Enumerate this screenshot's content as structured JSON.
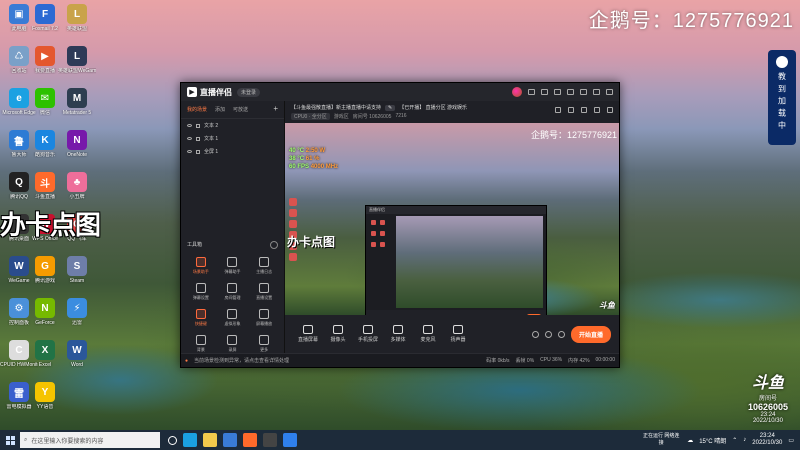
{
  "watermark": {
    "top_text": "企鹅号：1275776921",
    "big_text": "办卡点图"
  },
  "side_badge": {
    "label": "教 到 加 载 中"
  },
  "bottom_logo": {
    "brand": "斗鱼",
    "room_label": "房间号",
    "room_id": "10626005",
    "time": "23:24",
    "date": "2022/10/30"
  },
  "desktop_icons": [
    {
      "label": "此电脑",
      "color": "#3a7bd5",
      "glyph": "▣"
    },
    {
      "label": "Foxmail 7.2",
      "color": "#2c6ad3",
      "glyph": "F"
    },
    {
      "label": "英雄联盟",
      "color": "#c9a34a",
      "glyph": "L"
    },
    {
      "label": "回收站",
      "color": "#7aa0c8",
      "glyph": "♺"
    },
    {
      "label": "我要直播",
      "color": "#e4572e",
      "glyph": "▶"
    },
    {
      "label": "英雄联盟WeGame",
      "color": "#2e3a57",
      "glyph": "L"
    },
    {
      "label": "Microsoft Edge",
      "color": "#1ba1e2",
      "glyph": "e"
    },
    {
      "label": "微信",
      "color": "#2dc100",
      "glyph": "✉"
    },
    {
      "label": "Metatrader 5",
      "color": "#2d3e50",
      "glyph": "M"
    },
    {
      "label": "鲁大师",
      "color": "#2d7bd4",
      "glyph": "鲁"
    },
    {
      "label": "酷狗音乐",
      "color": "#1b86e0",
      "glyph": "K"
    },
    {
      "label": "OneNote",
      "color": "#7719aa",
      "glyph": "N"
    },
    {
      "label": "腾讯QQ",
      "color": "#222",
      "glyph": "Q"
    },
    {
      "label": "斗鱼直播",
      "color": "#ff6a2b",
      "glyph": "斗"
    },
    {
      "label": "小丑牌",
      "color": "#ee6e9a",
      "glyph": "♣"
    },
    {
      "label": "腾讯桌面",
      "color": "#333",
      "glyph": "D"
    },
    {
      "label": "WPS Office",
      "color": "#c8102e",
      "glyph": "W"
    },
    {
      "label": "QQ 飞车",
      "color": "#e44",
      "glyph": "Q"
    },
    {
      "label": "WeGame",
      "color": "#2a4c8c",
      "glyph": "W"
    },
    {
      "label": "腾讯游戏",
      "color": "#f59b00",
      "glyph": "G"
    },
    {
      "label": "Steam",
      "color": "#6e7ea8",
      "glyph": "S"
    },
    {
      "label": "控制面板",
      "color": "#4a90d9",
      "glyph": "⚙"
    },
    {
      "label": "GeForce",
      "color": "#76b900",
      "glyph": "N"
    },
    {
      "label": "迅雷",
      "color": "#3b8de0",
      "glyph": "⚡"
    },
    {
      "label": "CPUID HWMonitor",
      "color": "#ddd",
      "glyph": "C"
    },
    {
      "label": "Excel",
      "color": "#217346",
      "glyph": "X"
    },
    {
      "label": "Word",
      "color": "#2b579a",
      "glyph": "W"
    },
    {
      "label": "雷电模拟器",
      "color": "#3a5fcd",
      "glyph": "雷"
    },
    {
      "label": "YY语音",
      "color": "#f5c400",
      "glyph": "Y"
    }
  ],
  "app": {
    "logo_text": "直播伴侣",
    "login_badge": "未登录",
    "left_tabs": [
      "我的场景",
      "添加",
      "可放送"
    ],
    "scenes": [
      "文本 2",
      "文本 1",
      "全屏 1"
    ],
    "tools_title": "工具箱",
    "tools": [
      {
        "label": "场景助手",
        "hot": true
      },
      {
        "label": "弹幕助手",
        "hot": false
      },
      {
        "label": "主播日志",
        "hot": false
      },
      {
        "label": "弹幕设置",
        "hot": false
      },
      {
        "label": "房间管理",
        "hot": false
      },
      {
        "label": "直播设置",
        "hot": false
      },
      {
        "label": "快捷键",
        "hot": true
      },
      {
        "label": "虚拟形象",
        "hot": false
      },
      {
        "label": "屏幕播放",
        "hot": false
      },
      {
        "label": "背景",
        "hot": false
      },
      {
        "label": "录屏",
        "hot": false
      },
      {
        "label": "更多",
        "hot": false
      }
    ],
    "stream_title": "【斗鱼最强散直播】新主播直播中请支持",
    "room_status": "【已开播】 直播分区 游戏娱乐",
    "line2_items": [
      "CPU0 · 全分区",
      "游戏区",
      "房间号 10626005",
      "7216"
    ],
    "preview_watermark": "企鹅号：1275776921",
    "preview_stats": [
      {
        "label": "40 °C",
        "val": "2:50 W"
      },
      {
        "label": "38 °C",
        "val": "61 %"
      },
      {
        "label": "60 FPS",
        "val": "4000 MHz"
      }
    ],
    "preview_brand": "斗鱼",
    "controls": [
      {
        "label": "直播屏幕"
      },
      {
        "label": "摄像头"
      },
      {
        "label": "手机投屏"
      },
      {
        "label": "多媒体"
      },
      {
        "label": "麦克风"
      },
      {
        "label": "扬声器"
      }
    ],
    "start_button": "开始直播",
    "status_warning": "当前场景检测到异常，请点击查看详情处理",
    "status_right": [
      "码率 0kb/s",
      "丢帧 0%",
      "CPU 36%",
      "内存 42%",
      "00:00:00"
    ]
  },
  "taskbar": {
    "search_placeholder": "在这里输入你要搜索的内容",
    "weather": "15°C 晴朗",
    "clock_time": "23:24",
    "clock_date": "2022/10/30",
    "tray_text": "正在运行 网络连接"
  }
}
